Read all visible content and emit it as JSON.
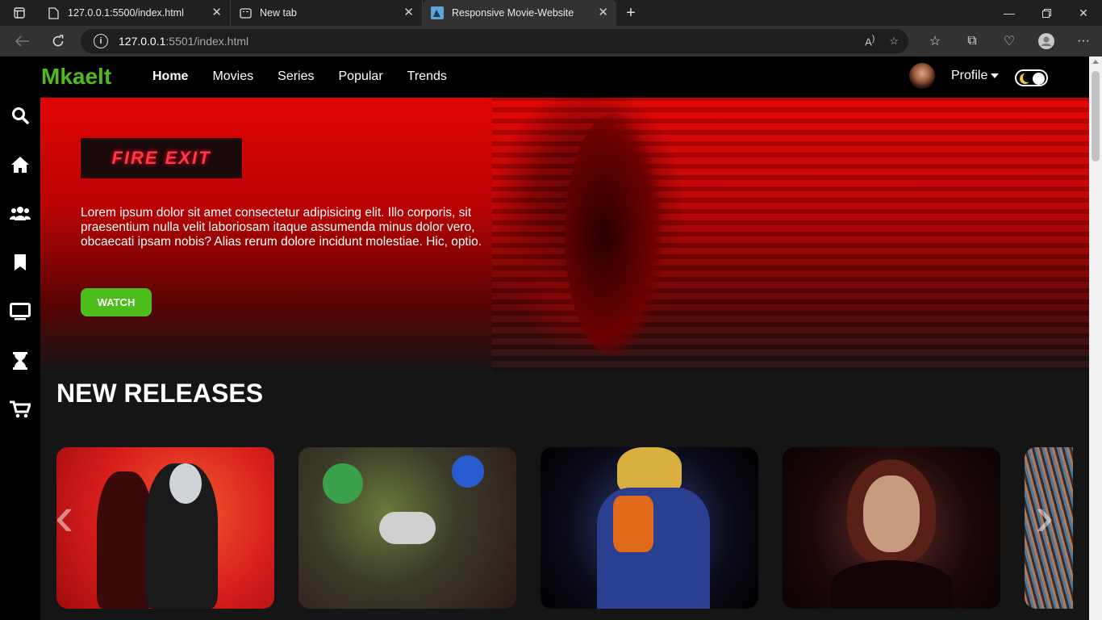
{
  "browser": {
    "tabs": [
      {
        "title": "127.0.0.1:5500/index.html",
        "icon": "page-icon",
        "active": false
      },
      {
        "title": "New tab",
        "icon": "newtab-icon",
        "active": false
      },
      {
        "title": "Responsive Movie-Website",
        "icon": "site-favicon",
        "active": true
      }
    ],
    "url_host": "127.0.0.1",
    "url_rest": ":5501/index.html"
  },
  "site": {
    "logo": "Mkaelt",
    "nav": [
      "Home",
      "Movies",
      "Series",
      "Popular",
      "Trends"
    ],
    "active_nav": "Home",
    "profile_label": "Profile",
    "accent_color": "#4dbd1c"
  },
  "sidebar": {
    "icons": [
      "search-icon",
      "home-icon",
      "users-icon",
      "bookmark-icon",
      "tv-icon",
      "hourglass-icon",
      "cart-icon"
    ]
  },
  "hero": {
    "title_image_text": "FIRE EXIT",
    "description": "Lorem ipsum dolor sit amet consectetur adipisicing elit. Illo corporis, sit praesentium nulla velit laboriosam itaque assumenda minus dolor vero, obcaecati ipsam nobis? Alias rerum dolore incidunt molestiae. Hic, optio.",
    "button_label": "WATCH"
  },
  "releases": {
    "title": "NEW RELEASES"
  }
}
